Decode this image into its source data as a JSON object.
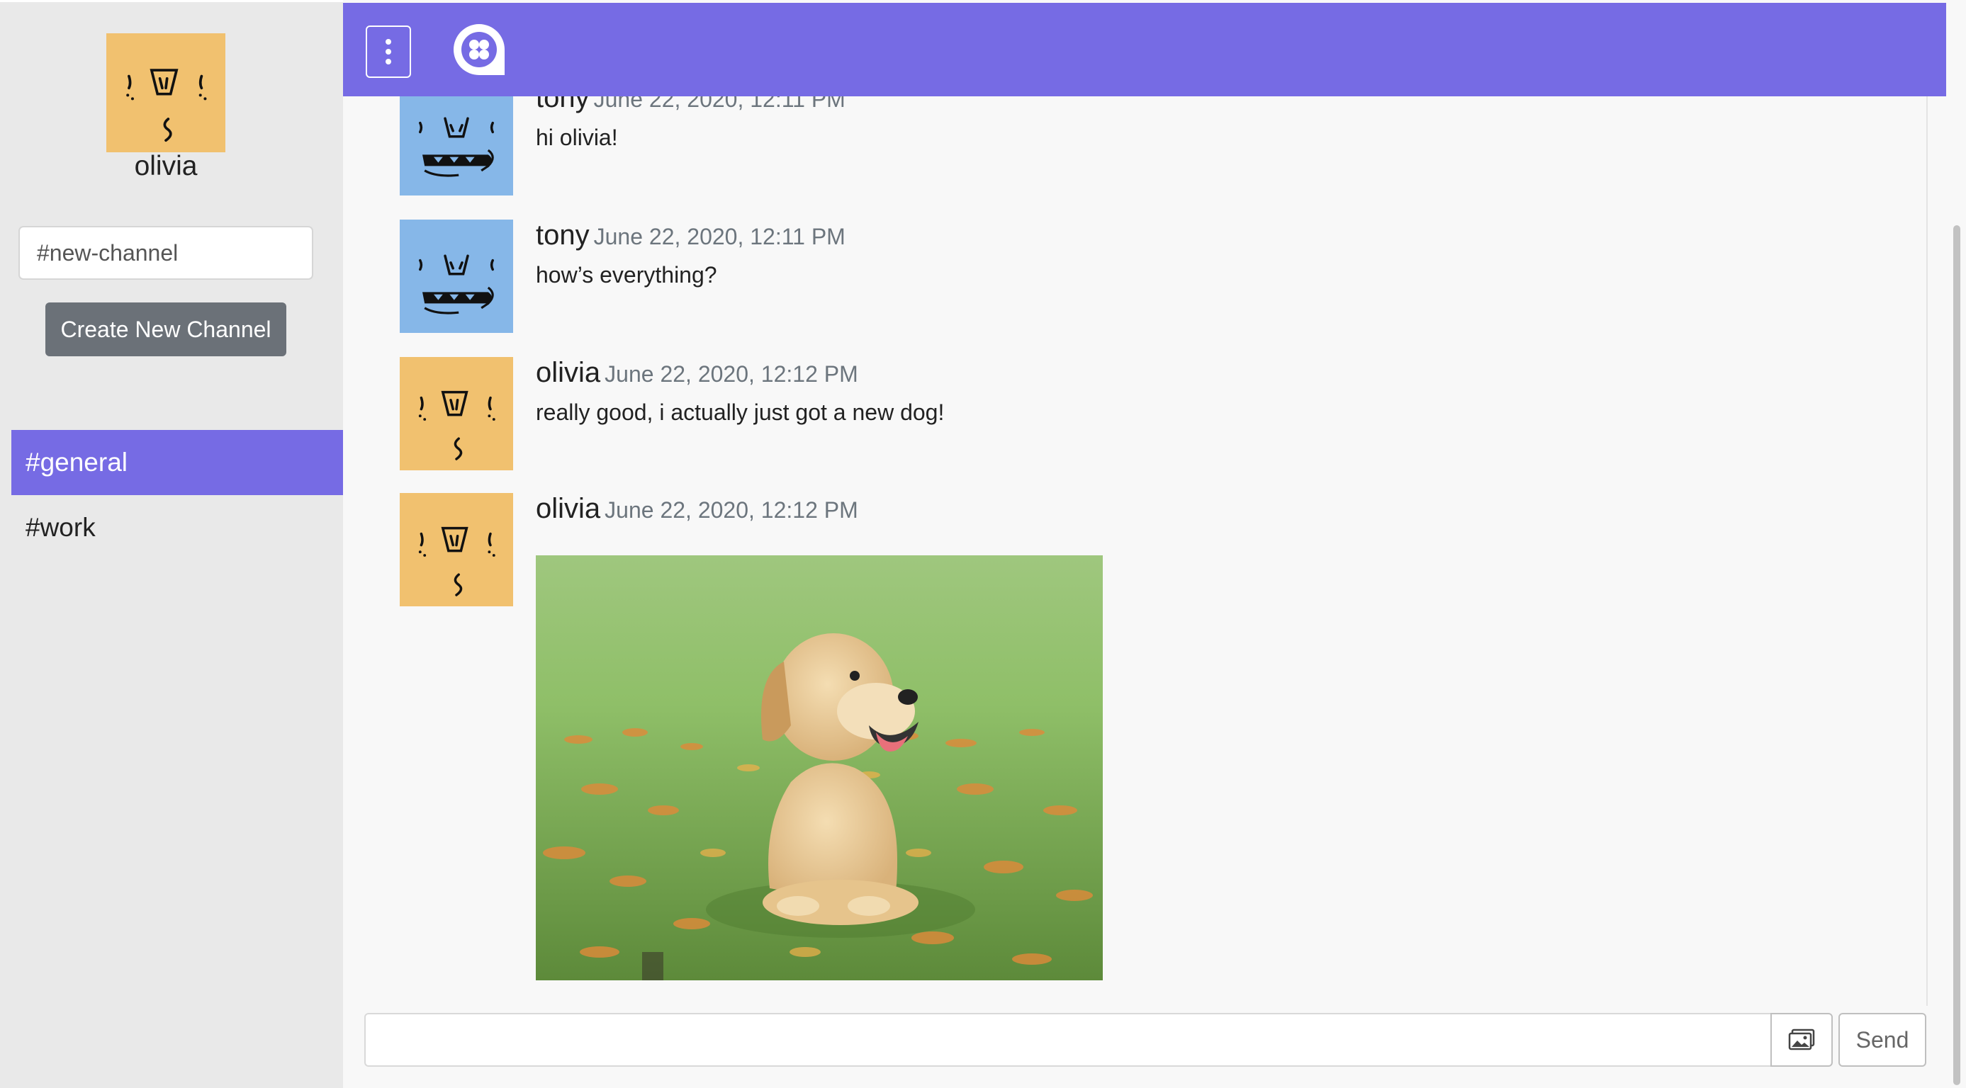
{
  "user": {
    "name": "olivia",
    "avatar_icon": "olivia-avatar-icon"
  },
  "sidebar": {
    "new_channel_placeholder": "#new-channel",
    "create_button_label": "Create New Channel",
    "channels": [
      {
        "label": "#general",
        "active": true
      },
      {
        "label": "#work",
        "active": false
      }
    ]
  },
  "topbar": {
    "menu_icon": "vertical-dots-icon",
    "logo_icon": "chat-app-logo-icon"
  },
  "messages": [
    {
      "author": "tony",
      "time": "June 22, 2020, 12:11 PM",
      "text": "hi olivia!"
    },
    {
      "author": "tony",
      "time": "June 22, 2020, 12:11 PM",
      "text": "how’s everything?"
    },
    {
      "author": "olivia",
      "time": "June 22, 2020, 12:12 PM",
      "text": "really good, i actually just got a new dog!"
    },
    {
      "author": "olivia",
      "time": "June 22, 2020, 12:12 PM",
      "text": "",
      "image": "puppy-photo"
    }
  ],
  "composer": {
    "input_value": "",
    "image_icon": "image-upload-icon",
    "send_label": "Send"
  },
  "colors": {
    "accent": "#766be4",
    "tony_avatar": "#86b7e8",
    "olivia_avatar": "#f1c16f",
    "button_gray": "#6b7178"
  }
}
